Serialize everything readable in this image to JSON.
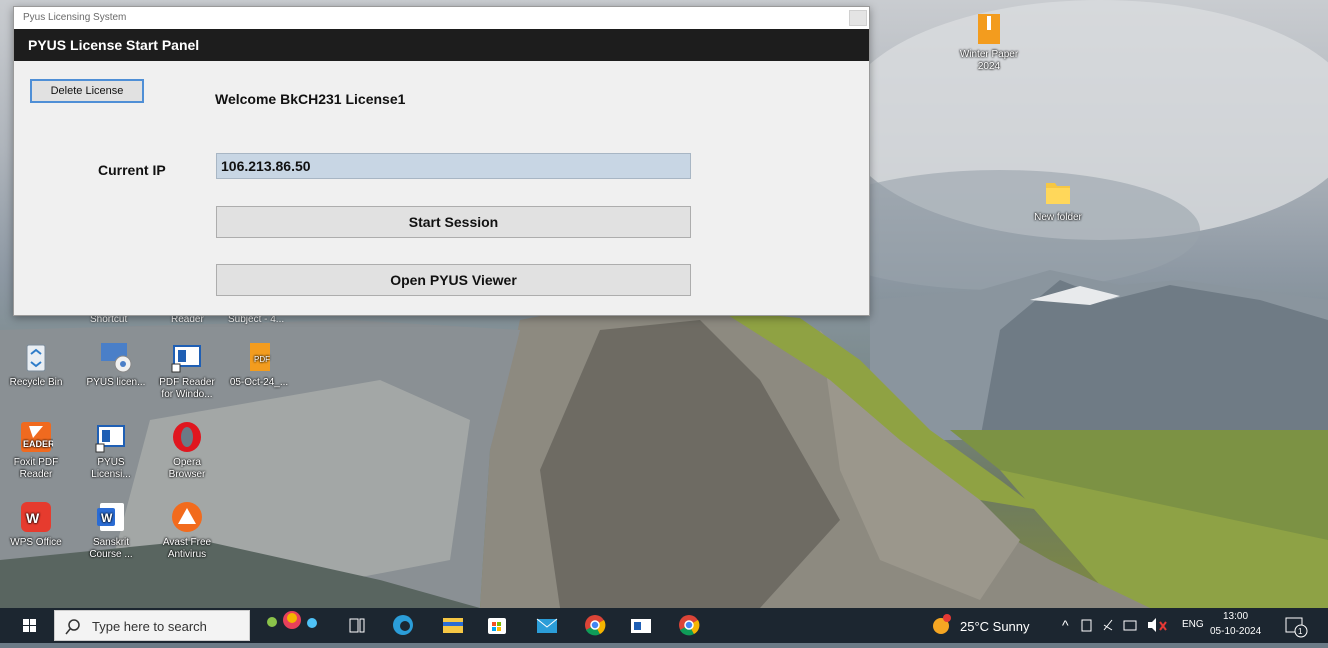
{
  "window": {
    "title": "Pyus Licensing System",
    "header": "PYUS License Start Panel",
    "delete_label": "Delete License",
    "welcome_text": "Welcome BkCH231  License1",
    "ip_label": "Current IP",
    "ip_value": "106.213.86.50",
    "start_label": "Start Session",
    "viewer_label": "Open PYUS Viewer"
  },
  "desktop": {
    "partial_labels": [
      "Shortcut",
      "Reader",
      "Subject - 4..."
    ],
    "icons": [
      {
        "label": "Recycle Bin",
        "icon": "recycle-bin-icon"
      },
      {
        "label": "PYUS licen...",
        "icon": "pyus-icon"
      },
      {
        "label": "PDF Reader for Windo...",
        "icon": "pdf-reader-icon"
      },
      {
        "label": "05-Oct-24_...",
        "icon": "pdf-file-icon"
      },
      {
        "label": "Foxit PDF Reader",
        "icon": "foxit-icon"
      },
      {
        "label": "PYUS Licensi...",
        "icon": "pyus-icon"
      },
      {
        "label": "Opera Browser",
        "icon": "opera-icon"
      },
      {
        "label": "WPS Office",
        "icon": "wps-icon"
      },
      {
        "label": "Sanskrit Course ...",
        "icon": "word-icon"
      },
      {
        "label": "Avast Free Antivirus",
        "icon": "avast-icon"
      },
      {
        "label": "Winter Paper 2024",
        "icon": "zip-icon"
      },
      {
        "label": "New folder",
        "icon": "folder-icon"
      }
    ]
  },
  "taskbar": {
    "search_placeholder": "Type here to search",
    "weather": "25°C  Sunny",
    "language": "ENG",
    "time": "13:00",
    "date": "05-10-2024"
  }
}
